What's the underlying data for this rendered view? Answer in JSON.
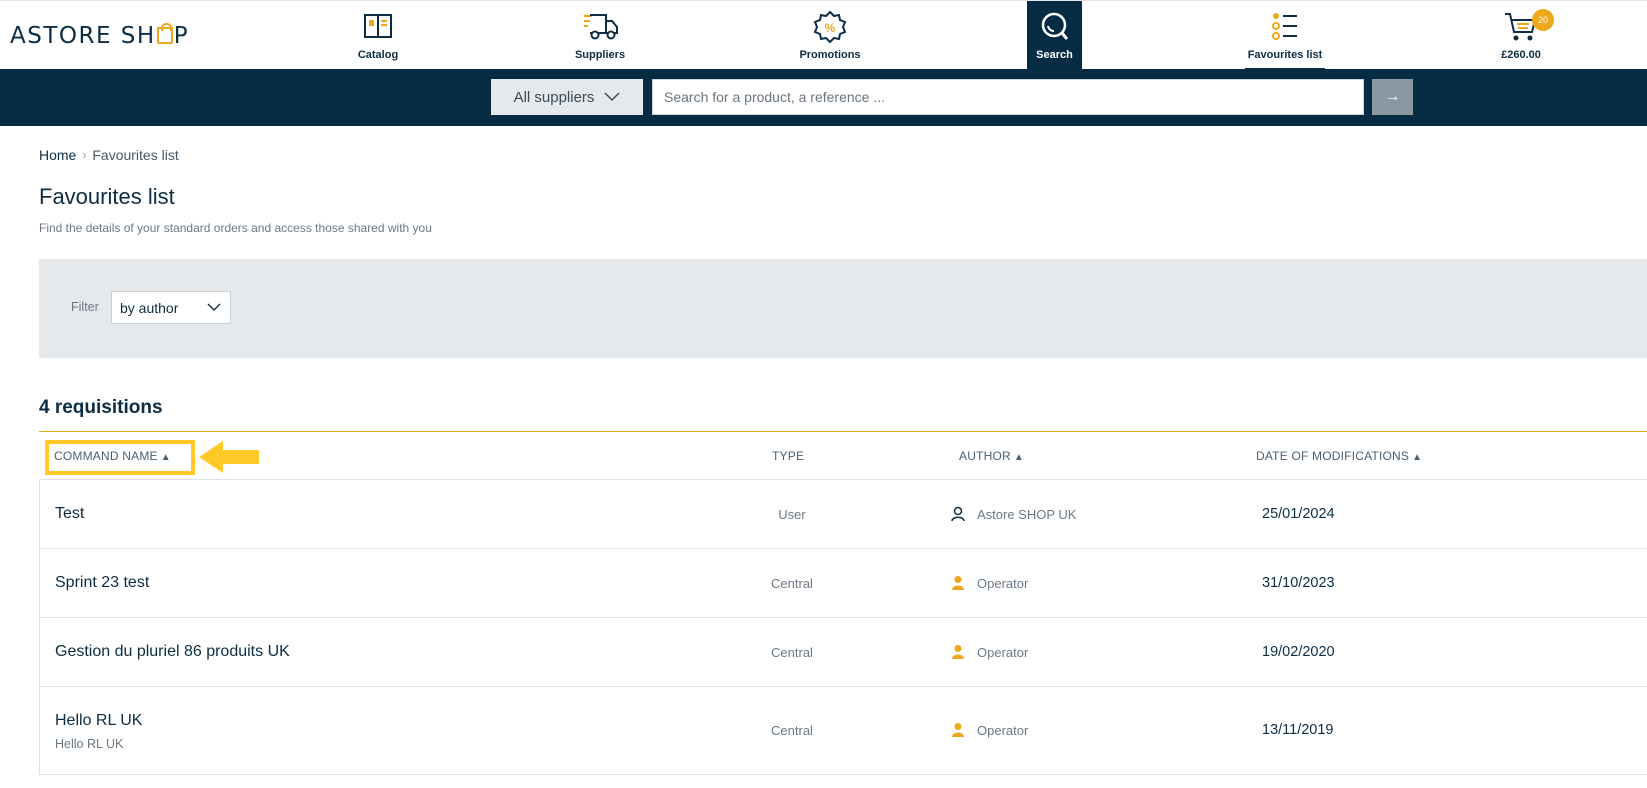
{
  "brand": {
    "logo_part1": "ASTORE SH",
    "logo_part2": "P"
  },
  "nav": {
    "catalog": "Catalog",
    "suppliers": "Suppliers",
    "promotions": "Promotions",
    "search": "Search",
    "favourites": "Favourites list",
    "cart_total": "£260.00",
    "cart_count": "20"
  },
  "search": {
    "supplier_filter": "All suppliers",
    "placeholder": "Search for a product, a reference ...",
    "go_symbol": "→"
  },
  "breadcrumb": {
    "home": "Home",
    "current": "Favourites list"
  },
  "page": {
    "title": "Favourites list",
    "subtitle": "Find the details of your standard orders and access those shared with you"
  },
  "filter": {
    "label": "Filter",
    "value": "by author"
  },
  "list": {
    "count_label": "4 requisitions",
    "columns": {
      "name": "COMMAND NAME",
      "type": "TYPE",
      "author": "AUTHOR",
      "date": "DATE OF MODIFICATIONS"
    },
    "sort_symbol": "▲",
    "rows": [
      {
        "name": "Test",
        "subtitle": "",
        "type": "User",
        "author": "Astore SHOP UK",
        "author_icon": "user-outline-icon",
        "date": "25/01/2024"
      },
      {
        "name": "Sprint 23 test",
        "subtitle": "",
        "type": "Central",
        "author": "Operator",
        "author_icon": "user-filled-icon",
        "date": "31/10/2023"
      },
      {
        "name": "Gestion du pluriel 86 produits UK",
        "subtitle": "",
        "type": "Central",
        "author": "Operator",
        "author_icon": "user-filled-icon",
        "date": "19/02/2020"
      },
      {
        "name": "Hello RL UK",
        "subtitle": "Hello RL UK",
        "type": "Central",
        "author": "Operator",
        "author_icon": "user-filled-icon",
        "date": "13/11/2019"
      }
    ]
  },
  "colors": {
    "navy": "#062c44",
    "accent": "#efa81e",
    "highlight": "#ffc928"
  }
}
